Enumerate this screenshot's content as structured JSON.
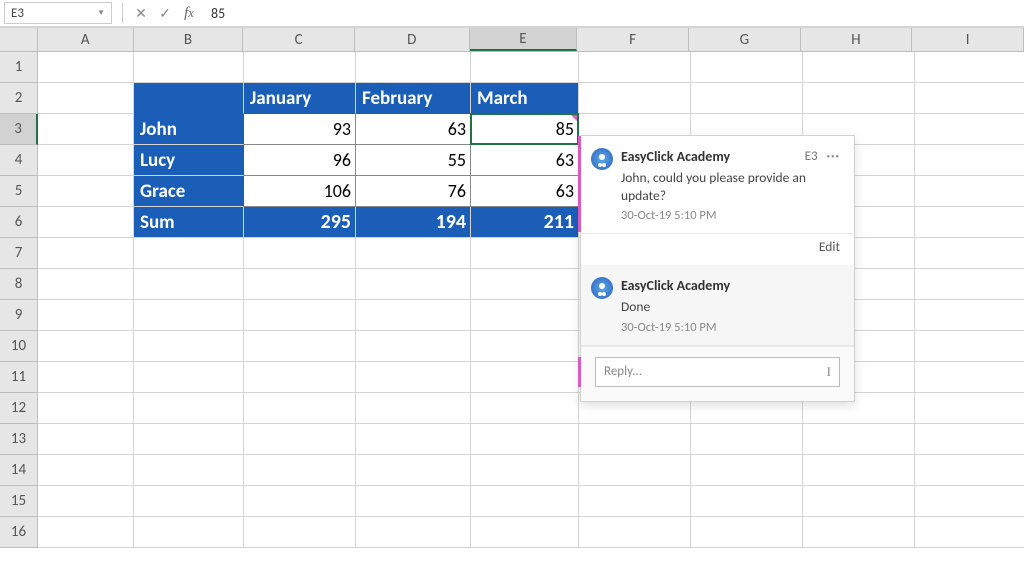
{
  "namebox": "E3",
  "formula_value": "85",
  "columns": [
    "A",
    "B",
    "C",
    "D",
    "E",
    "F",
    "G",
    "H",
    "I"
  ],
  "active_col": "E",
  "active_row": 3,
  "row_count": 16,
  "table": {
    "headers": [
      "",
      "January",
      "February",
      "March"
    ],
    "rows": [
      {
        "label": "John",
        "values": [
          93,
          63,
          85
        ]
      },
      {
        "label": "Lucy",
        "values": [
          96,
          55,
          63
        ]
      },
      {
        "label": "Grace",
        "values": [
          106,
          76,
          63
        ]
      }
    ],
    "sum_label": "Sum",
    "sum_values": [
      295,
      194,
      211
    ]
  },
  "comment": {
    "thread": [
      {
        "author": "EasyClick Academy",
        "cell_ref": "E3",
        "text": "John, could you please provide an update?",
        "timestamp": "30-Oct-19 5:10 PM"
      },
      {
        "author": "EasyClick Academy",
        "text": "Done",
        "timestamp": "30-Oct-19 5:10 PM"
      }
    ],
    "edit_label": "Edit",
    "reply_placeholder": "Reply..."
  }
}
